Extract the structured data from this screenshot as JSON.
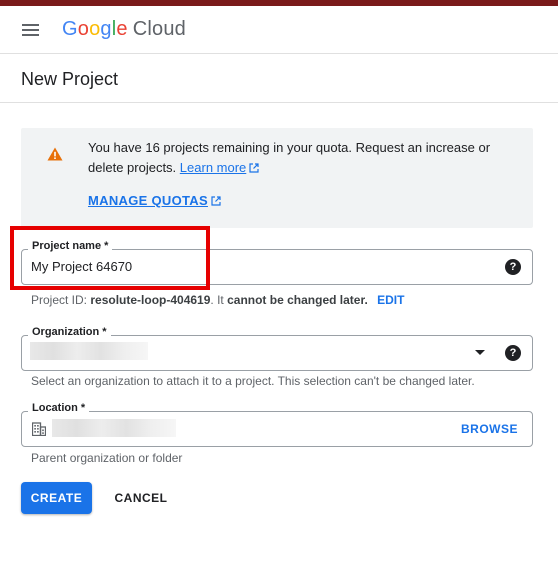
{
  "app": {
    "logo_letters": [
      "G",
      "o",
      "o",
      "g",
      "l",
      "e"
    ],
    "logo_product": "Cloud",
    "brand_colors": [
      "#4285F4",
      "#EA4335",
      "#FBBC05",
      "#4285F4",
      "#34A853",
      "#EA4335"
    ]
  },
  "page": {
    "title": "New Project"
  },
  "quota_notice": {
    "text": "You have 16 projects remaining in your quota. Request an increase or delete projects.",
    "learn_more": "Learn more",
    "manage_quotas": "MANAGE QUOTAS",
    "icon": "warning-icon",
    "icon_color": "#e8710a"
  },
  "project_name": {
    "label": "Project name *",
    "value": "My Project 64670",
    "id_prefix": "Project ID:",
    "id_value": "resolute-loop-404619",
    "id_suffix_1": ". It",
    "id_suffix_bold": "cannot be changed later.",
    "edit": "EDIT"
  },
  "organization": {
    "label": "Organization *",
    "hint": "Select an organization to attach it to a project. This selection can't be changed later."
  },
  "location": {
    "label": "Location *",
    "browse": "BROWSE",
    "hint": "Parent organization or folder"
  },
  "actions": {
    "create": "CREATE",
    "cancel": "CANCEL"
  },
  "colors": {
    "primary": "#1a73e8",
    "highlight": "#e60000",
    "top_strip": "#7a1a1a"
  }
}
